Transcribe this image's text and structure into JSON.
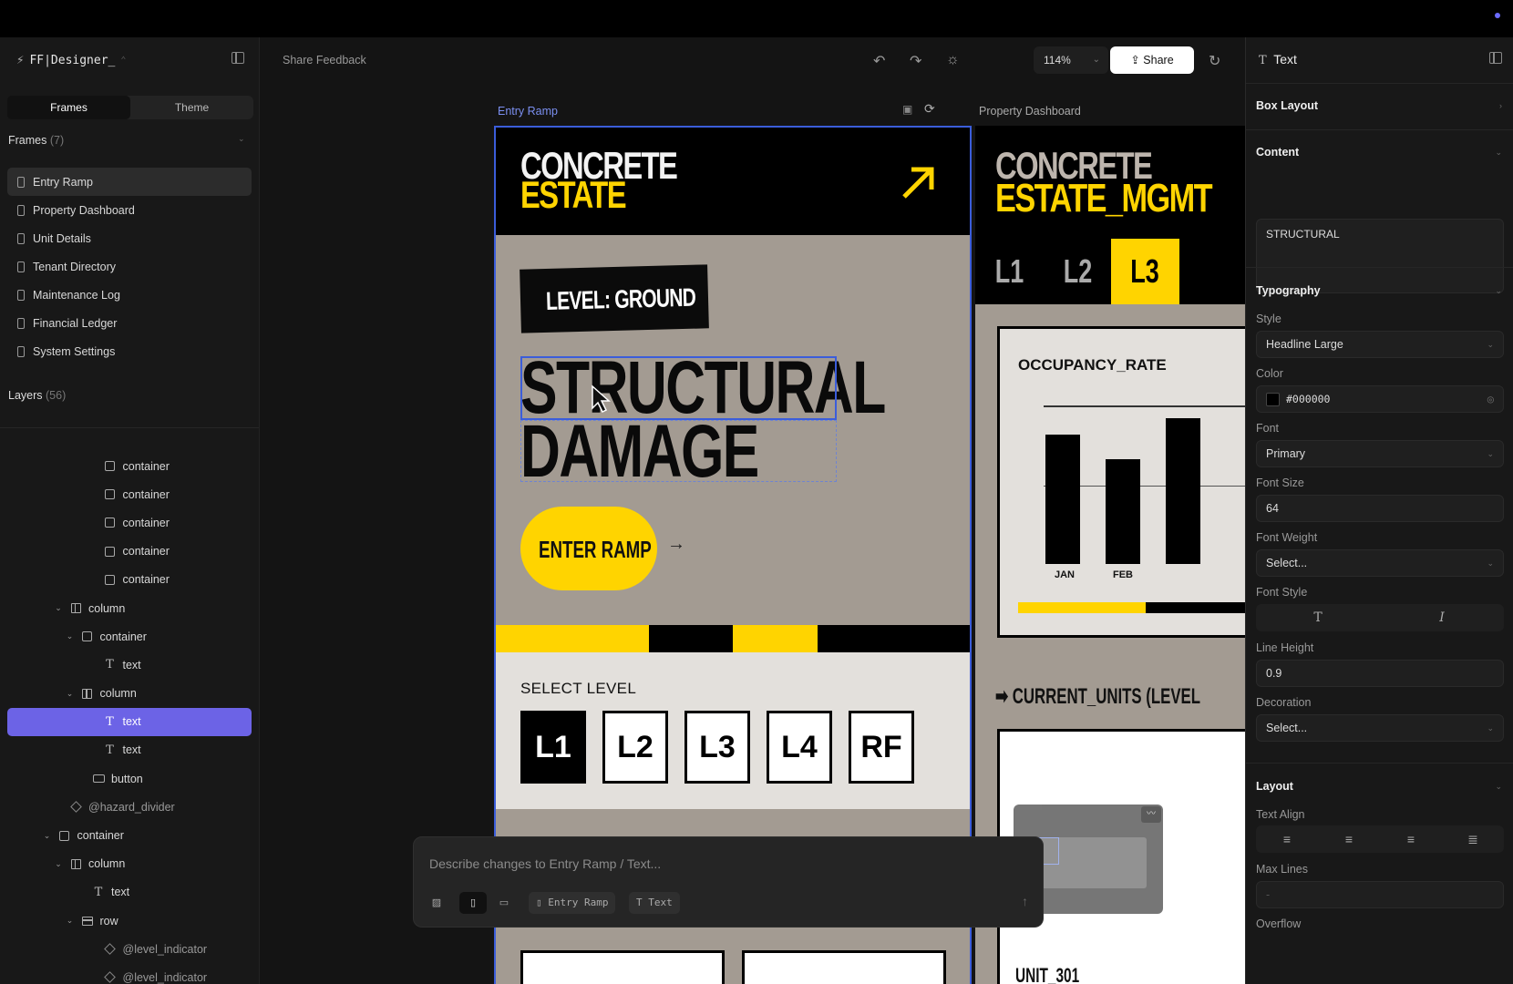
{
  "app": {
    "name": "FF|Designer_"
  },
  "left": {
    "tabs": [
      "Frames",
      "Theme"
    ],
    "frames_title": "Frames",
    "frames_count": "(7)",
    "frames": [
      "Entry Ramp",
      "Property Dashboard",
      "Unit Details",
      "Tenant Directory",
      "Maintenance Log",
      "Financial Ledger",
      "System Settings"
    ],
    "layers_title": "Layers",
    "layers_count": "(56)",
    "layers": [
      {
        "label": "container",
        "indent": 7,
        "icon": "container",
        "caret": false
      },
      {
        "label": "container",
        "indent": 7,
        "icon": "container",
        "caret": false
      },
      {
        "label": "container",
        "indent": 7,
        "icon": "container",
        "caret": false
      },
      {
        "label": "container",
        "indent": 7,
        "icon": "container",
        "caret": false
      },
      {
        "label": "container",
        "indent": 7,
        "icon": "container",
        "caret": false
      },
      {
        "label": "column",
        "indent": 4,
        "icon": "column",
        "caret": true
      },
      {
        "label": "container",
        "indent": 5,
        "icon": "container",
        "caret": true
      },
      {
        "label": "text",
        "indent": 7,
        "icon": "text",
        "caret": false
      },
      {
        "label": "column",
        "indent": 5,
        "icon": "column",
        "caret": true
      },
      {
        "label": "text",
        "indent": 7,
        "icon": "text",
        "caret": false,
        "selected": true
      },
      {
        "label": "text",
        "indent": 7,
        "icon": "text",
        "caret": false
      },
      {
        "label": "button",
        "indent": 6,
        "icon": "button",
        "caret": false
      },
      {
        "label": "@hazard_divider",
        "indent": 4,
        "icon": "component",
        "caret": false
      },
      {
        "label": "container",
        "indent": 3,
        "icon": "container",
        "caret": true
      },
      {
        "label": "column",
        "indent": 4,
        "icon": "column",
        "caret": true
      },
      {
        "label": "text",
        "indent": 6,
        "icon": "text",
        "caret": false
      },
      {
        "label": "row",
        "indent": 5,
        "icon": "row",
        "caret": true
      },
      {
        "label": "@level_indicator",
        "indent": 7,
        "icon": "component",
        "caret": false
      },
      {
        "label": "@level_indicator",
        "indent": 7,
        "icon": "component",
        "caret": false
      }
    ]
  },
  "toolbar": {
    "feedback": "Share Feedback",
    "zoom": "114%",
    "share": "Share"
  },
  "canvas": {
    "frame1": {
      "label": "Entry Ramp",
      "logo1": "CONCRETE",
      "logo2": "ESTATE",
      "level": "LEVEL: GROUND",
      "headline1": "STRUCTURAL",
      "headline2": "DAMAGE",
      "cta": "ENTER RAMP",
      "select_level": "SELECT LEVEL",
      "levels": [
        "L1",
        "L2",
        "L3",
        "L4",
        "RF"
      ]
    },
    "frame2": {
      "label": "Property Dashboard",
      "logo1": "CONCRETE",
      "logo2": "ESTATE_MGMT",
      "tabs": [
        "L1",
        "L2",
        "L3"
      ],
      "occupancy": "OCCUPANCY_RATE",
      "months": [
        "JAN",
        "FEB"
      ],
      "current_units": "➡ CURRENT_UNITS (LEVEL",
      "unit": "UNIT_301"
    }
  },
  "prompt": {
    "placeholder": "Describe changes to Entry Ramp / Text...",
    "chip1": "Entry Ramp",
    "chip2": "Text"
  },
  "right": {
    "title": "Text",
    "box_layout": "Box Layout",
    "content_h": "Content",
    "content": "STRUCTURAL",
    "typography": "Typography",
    "style_l": "Style",
    "style": "Headline Large",
    "color_l": "Color",
    "color": "#000000",
    "font_l": "Font",
    "font": "Primary",
    "size_l": "Font Size",
    "size": "64",
    "weight_l": "Font Weight",
    "weight": "Select...",
    "fstyle_l": "Font Style",
    "lh_l": "Line Height",
    "lh": "0.9",
    "deco_l": "Decoration",
    "deco": "Select...",
    "layout": "Layout",
    "align_l": "Text Align",
    "maxl_l": "Max Lines",
    "maxl": "-",
    "overflow_l": "Overflow"
  },
  "colors": {
    "accent": "#6c63e6",
    "brand_yellow": "#ffd400",
    "frame_bg": "#a39b92",
    "selection": "#3b5dda"
  }
}
